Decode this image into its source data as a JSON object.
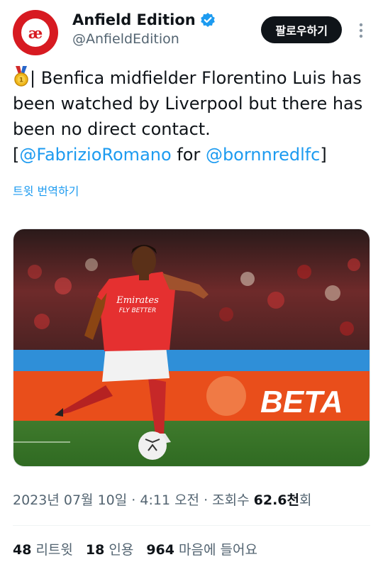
{
  "author": {
    "display_name": "Anfield Edition",
    "handle": "@AnfieldEdition",
    "avatar_text": "æ",
    "verified": true
  },
  "actions": {
    "follow_label": "팔로우하기"
  },
  "tweet": {
    "text_intro": "| Benfica midfielder Florentino Luis has been watched by Liverpool but there has been no direct contact. [",
    "mention_1": "@FabrizioRomano",
    "text_mid": " for ",
    "mention_2": "@bornnredlfc",
    "text_end": "]",
    "translate_label": "트윗 번역하기"
  },
  "media": {
    "sponsor_shirt": "Emirates",
    "sponsor_sub": "FLY BETTER",
    "board_text": "BETA"
  },
  "meta": {
    "date": "2023년 07월 10일",
    "sep1": " · ",
    "time": "4:11 오전",
    "sep2": " · ",
    "views_label": "조회수 ",
    "views_count": "62.6천",
    "views_suffix": "회"
  },
  "stats": {
    "retweets_count": "48",
    "retweets_label": "리트윗",
    "quotes_count": "18",
    "quotes_label": "인용",
    "likes_count": "964",
    "likes_label": "마음에 들어요"
  },
  "colors": {
    "link": "#1d9bf0",
    "verified": "#1d9bf0",
    "brand": "#d71a21",
    "follow_bg": "#0f1419"
  }
}
